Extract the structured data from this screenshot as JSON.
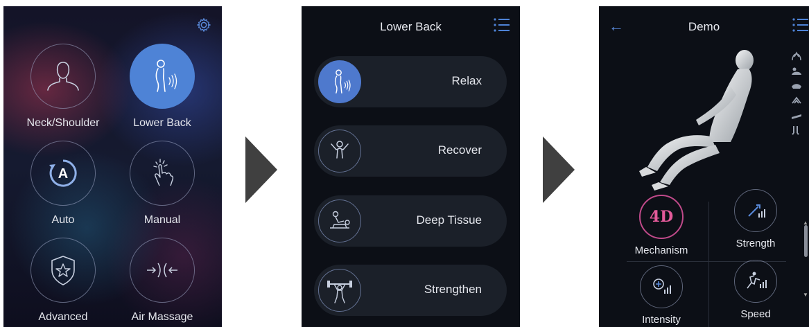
{
  "screen1": {
    "settings_icon": "gear-icon",
    "menu": [
      {
        "label": "Neck/Shoulder",
        "icon": "neck-shoulder-icon",
        "active": false
      },
      {
        "label": "Lower Back",
        "icon": "lower-back-icon",
        "active": true
      },
      {
        "label": "Auto",
        "icon": "auto-icon",
        "active": false
      },
      {
        "label": "Manual",
        "icon": "manual-icon",
        "active": false
      },
      {
        "label": "Advanced",
        "icon": "advanced-icon",
        "active": false
      },
      {
        "label": "Air Massage",
        "icon": "air-massage-icon",
        "active": false
      }
    ]
  },
  "screen2": {
    "title": "Lower Back",
    "menu_icon": "list-icon",
    "programs": [
      {
        "label": "Relax",
        "icon": "relax-icon",
        "active": true
      },
      {
        "label": "Recover",
        "icon": "recover-icon",
        "active": false
      },
      {
        "label": "Deep Tissue",
        "icon": "deep-tissue-icon",
        "active": false
      },
      {
        "label": "Strengthen",
        "icon": "strengthen-icon",
        "active": false
      }
    ]
  },
  "screen3": {
    "title": "Demo",
    "back_icon": "back-arrow-icon",
    "menu_icon": "list-icon",
    "mechanism_badge": "4D",
    "controls": [
      {
        "label": "Mechanism",
        "icon": "4d-icon"
      },
      {
        "label": "Strength",
        "icon": "strength-icon"
      },
      {
        "label": "Intensity",
        "icon": "intensity-icon"
      },
      {
        "label": "Speed",
        "icon": "speed-icon"
      }
    ]
  },
  "colors": {
    "accent_blue": "#4e83d6",
    "screen_bg": "#0c0f16",
    "pill_bg": "#1b2029",
    "fourd_pink": "#e45a9a",
    "arrow_gray": "#404040"
  }
}
